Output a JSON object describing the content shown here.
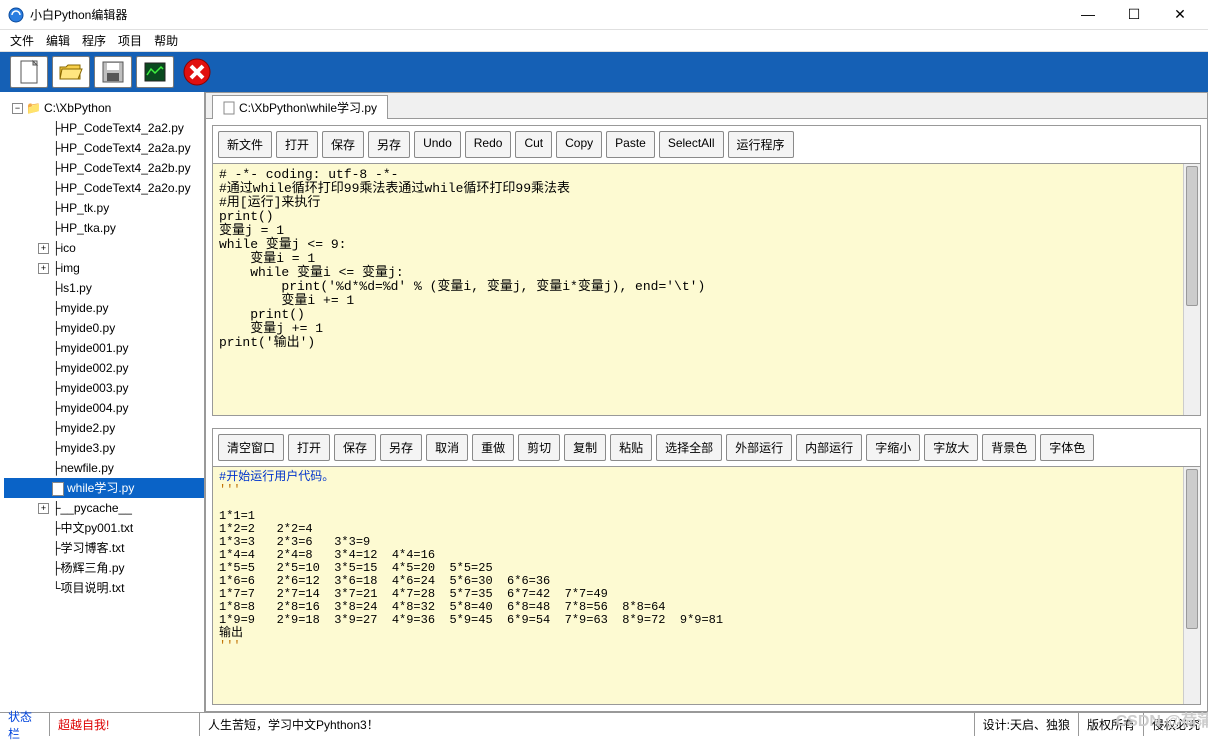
{
  "window": {
    "title": "小白Python编辑器",
    "min": "—",
    "max": "☐",
    "close": "✕"
  },
  "menu": [
    "文件",
    "编辑",
    "程序",
    "项目",
    "帮助"
  ],
  "toolbar_icons": [
    "new-file-icon",
    "open-folder-icon",
    "save-disk-icon",
    "run-icon",
    "stop-icon"
  ],
  "tree": {
    "root": "C:\\XbPython",
    "items": [
      {
        "label": "├HP_CodeText4_2a2.py",
        "indent": 1,
        "type": "file"
      },
      {
        "label": "├HP_CodeText4_2a2a.py",
        "indent": 1,
        "type": "file"
      },
      {
        "label": "├HP_CodeText4_2a2b.py",
        "indent": 1,
        "type": "file"
      },
      {
        "label": "├HP_CodeText4_2a2o.py",
        "indent": 1,
        "type": "file"
      },
      {
        "label": "├HP_tk.py",
        "indent": 1,
        "type": "file"
      },
      {
        "label": "├HP_tka.py",
        "indent": 1,
        "type": "file"
      },
      {
        "label": "├ico",
        "indent": 1,
        "type": "folder",
        "exp": "+"
      },
      {
        "label": "├img",
        "indent": 1,
        "type": "folder",
        "exp": "+"
      },
      {
        "label": "├ls1.py",
        "indent": 1,
        "type": "file"
      },
      {
        "label": "├myide.py",
        "indent": 1,
        "type": "file"
      },
      {
        "label": "├myide0.py",
        "indent": 1,
        "type": "file"
      },
      {
        "label": "├myide001.py",
        "indent": 1,
        "type": "file"
      },
      {
        "label": "├myide002.py",
        "indent": 1,
        "type": "file"
      },
      {
        "label": "├myide003.py",
        "indent": 1,
        "type": "file"
      },
      {
        "label": "├myide004.py",
        "indent": 1,
        "type": "file"
      },
      {
        "label": "├myide2.py",
        "indent": 1,
        "type": "file"
      },
      {
        "label": "├myide3.py",
        "indent": 1,
        "type": "file"
      },
      {
        "label": "├newfile.py",
        "indent": 1,
        "type": "file"
      },
      {
        "label": "while学习.py",
        "indent": 1,
        "type": "file",
        "selected": true,
        "prefix": "├"
      },
      {
        "label": "├__pycache__",
        "indent": 1,
        "type": "folder",
        "exp": "+"
      },
      {
        "label": "├中文py001.txt",
        "indent": 1,
        "type": "file"
      },
      {
        "label": "├学习博客.txt",
        "indent": 1,
        "type": "file"
      },
      {
        "label": "├杨辉三角.py",
        "indent": 1,
        "type": "file"
      },
      {
        "label": "└项目说明.txt",
        "indent": 1,
        "type": "file"
      }
    ]
  },
  "tab": {
    "path": "C:\\XbPython\\while学习.py"
  },
  "editor_buttons": [
    "新文件",
    "打开",
    "保存",
    "另存",
    "Undo",
    "Redo",
    "Cut",
    "Copy",
    "Paste",
    "SelectAll",
    "运行程序"
  ],
  "output_buttons": [
    "清空窗口",
    "打开",
    "保存",
    "另存",
    "取消",
    "重做",
    "剪切",
    "复制",
    "粘贴",
    "选择全部",
    "外部运行",
    "内部运行",
    "字缩小",
    "字放大",
    "背景色",
    "字体色"
  ],
  "code": {
    "l1": "# -*- coding: utf-8 -*-",
    "l2": "#通过while循环打印99乘法表通过while循环打印99乘法表",
    "l3": "#用[运行]来执行",
    "l4": "print()",
    "l5": "变量j = 1",
    "l6": "while 变量j <= 9:",
    "l7": "    变量i = 1",
    "l8": "    while 变量i <= 变量j:",
    "l9": "        print('%d*%d=%d' % (变量i, 变量j, 变量i*变量j), end='\\t')",
    "l10": "        变量i += 1",
    "l11": "    print()",
    "l12": "    变量j += 1",
    "l13": "print('输出')"
  },
  "output": {
    "header": "#开始运行用户代码。",
    "q1": "'''",
    "lines": [
      "1*1=1",
      "1*2=2   2*2=4",
      "1*3=3   2*3=6   3*3=9",
      "1*4=4   2*4=8   3*4=12  4*4=16",
      "1*5=5   2*5=10  3*5=15  4*5=20  5*5=25",
      "1*6=6   2*6=12  3*6=18  4*6=24  5*6=30  6*6=36",
      "1*7=7   2*7=14  3*7=21  4*7=28  5*7=35  6*7=42  7*7=49",
      "1*8=8   2*8=16  3*8=24  4*8=32  5*8=40  6*8=48  7*8=56  8*8=64",
      "1*9=9   2*9=18  3*9=27  4*9=36  5*9=45  6*9=54  7*9=63  8*9=72  9*9=81",
      "输出"
    ],
    "q2": "'''"
  },
  "status": {
    "label": "状态栏",
    "motto": "超越自我!",
    "middle": "人生苦短，学习中文Pyhthon3！",
    "right1": "设计:天启、独狼",
    "right2": "版权所有",
    "right3": "侵权必究",
    "watermark": "CSDN @荷蒲"
  }
}
